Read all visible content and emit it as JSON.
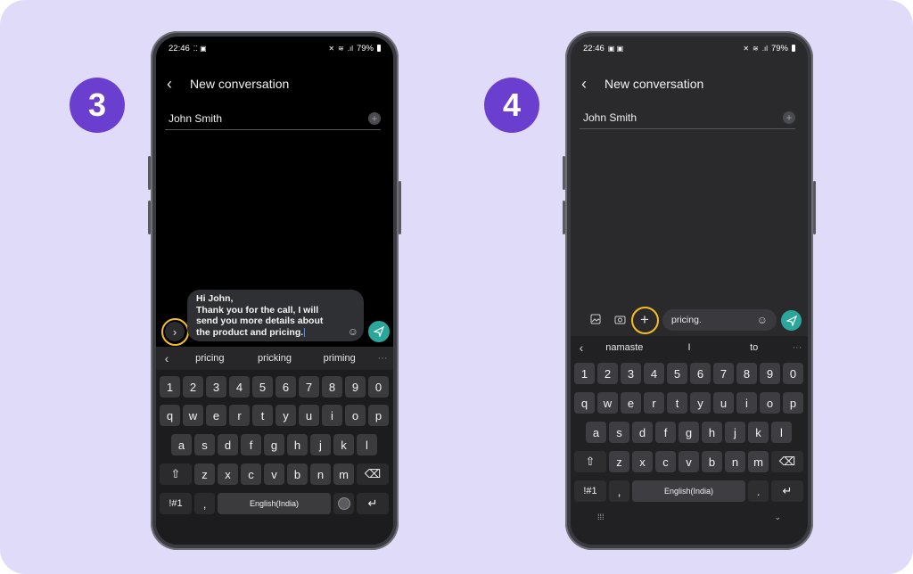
{
  "steps": {
    "left": "3",
    "right": "4"
  },
  "status": {
    "time": "22:46",
    "battery": "79%"
  },
  "conversation": {
    "title": "New conversation",
    "recipient": "John Smith"
  },
  "left": {
    "message_lines": [
      "Hi John,",
      "Thank you for the call, I will",
      "send you more details about",
      "the product and pricing."
    ],
    "suggestions": [
      "pricing",
      "pricking",
      "priming"
    ],
    "space_label": "English(India)",
    "symbols_label": "!#1"
  },
  "right": {
    "input_value": "pricing.",
    "suggestions": [
      "namaste",
      "I",
      "to"
    ],
    "space_label": "English(India)",
    "symbols_label": "!#1"
  },
  "keyboard": {
    "numbers": [
      "1",
      "2",
      "3",
      "4",
      "5",
      "6",
      "7",
      "8",
      "9",
      "0"
    ],
    "row1": [
      "q",
      "w",
      "e",
      "r",
      "t",
      "y",
      "u",
      "i",
      "o",
      "p"
    ],
    "row2": [
      "a",
      "s",
      "d",
      "f",
      "g",
      "h",
      "j",
      "k",
      "l"
    ],
    "row3": [
      "z",
      "x",
      "c",
      "v",
      "b",
      "n",
      "m"
    ],
    "comma": ",",
    "period": "."
  },
  "colors": {
    "accent": "#6a3fd0",
    "highlight": "#f5bd1f",
    "send": "#2aa69a",
    "background": "#e1dbfa"
  }
}
